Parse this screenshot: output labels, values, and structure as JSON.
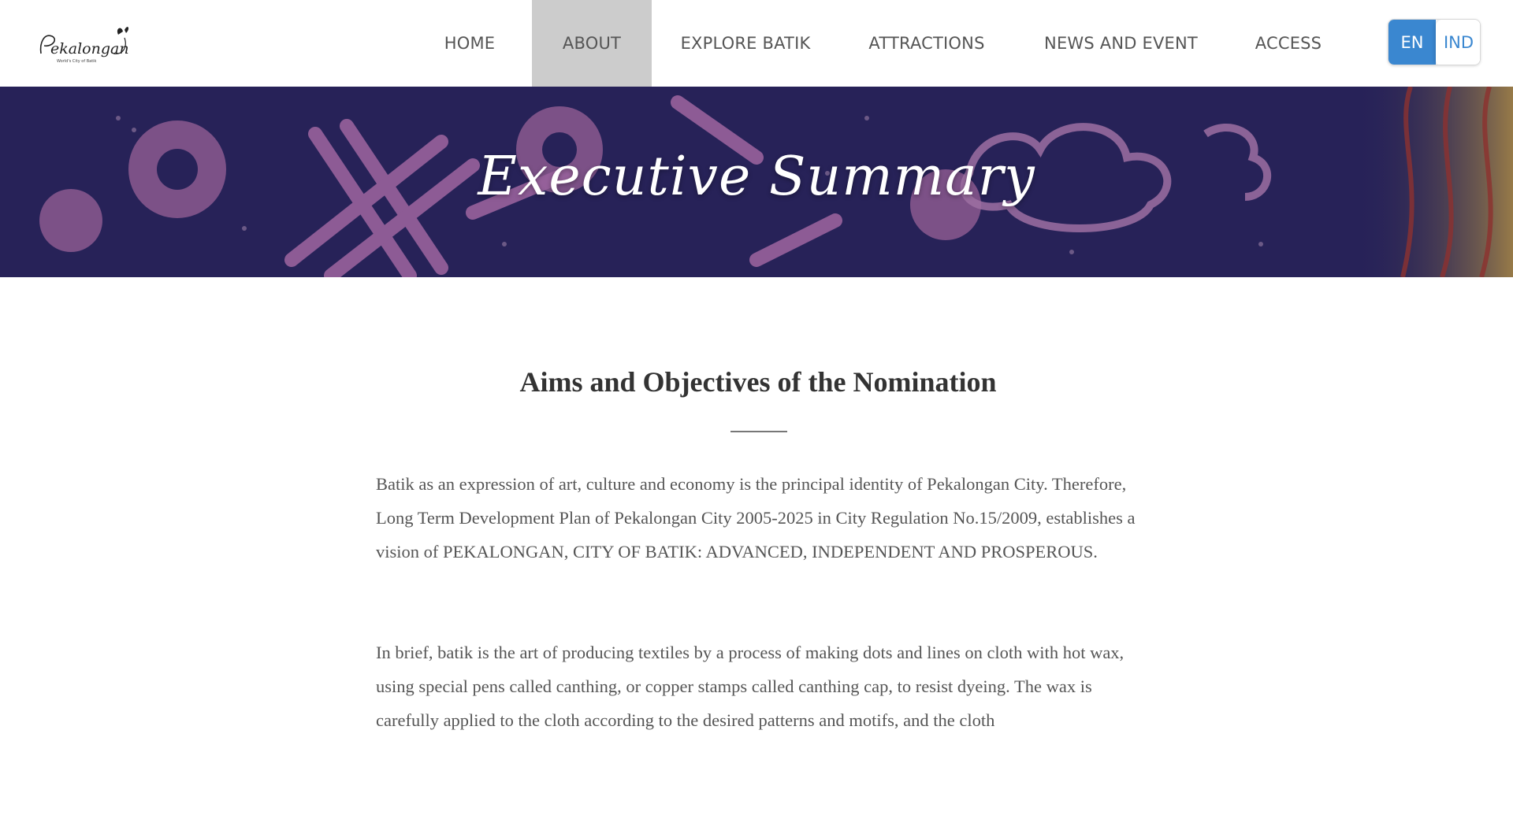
{
  "logo": {
    "text": "Pekalongan",
    "tagline": "World's City of Batik"
  },
  "nav": {
    "items": [
      {
        "label": "HOME"
      },
      {
        "label": "ABOUT"
      },
      {
        "label": "EXPLORE BATIK"
      },
      {
        "label": "ATTRACTIONS"
      },
      {
        "label": "NEWS AND EVENT"
      },
      {
        "label": "ACCESS"
      }
    ],
    "active": "ABOUT"
  },
  "language": {
    "en": "EN",
    "ind": "IND",
    "selected": "EN"
  },
  "banner": {
    "title": "Executive Summary"
  },
  "section": {
    "title": "Aims and Objectives of the Nomination",
    "paragraphs": [
      "Batik as an expression of art, culture and economy is the principal identity of Pekalongan City. Therefore, Long Term Development Plan of Pekalongan City 2005-2025 in City Regulation No.15/2009, establishes a vision of PEKALONGAN, CITY OF BATIK: ADVANCED, INDEPENDENT AND PROSPEROUS.",
      "In brief, batik is the art of producing textiles by a process of making dots and lines on cloth with hot wax, using special pens called canthing, or copper stamps called canthing cap, to resist dyeing. The wax is carefully applied to the cloth according to the desired patterns and motifs, and the cloth"
    ]
  },
  "colors": {
    "accent": "#3a87d0",
    "nav_active_bg": "#cccccc",
    "banner_bg": "#2a2560",
    "pattern_pink": "#c77cc0"
  }
}
